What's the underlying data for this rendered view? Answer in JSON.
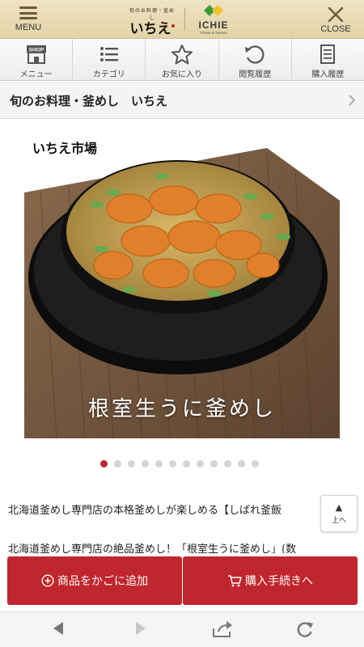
{
  "header": {
    "menu_label": "MENU",
    "close_label": "CLOSE",
    "logo_left_small": "旬のお料理・釜めし",
    "logo_left_main": "いちえ",
    "logo_right_word": "ICHIE",
    "logo_right_sub": "Flower & Sweets"
  },
  "nav": {
    "items": [
      {
        "label": "メニュー",
        "icon": "shop-icon",
        "badge": "SHOP"
      },
      {
        "label": "カテゴリ",
        "icon": "list-icon"
      },
      {
        "label": "お気に入り",
        "icon": "star-icon"
      },
      {
        "label": "閲覧履歴",
        "icon": "history-icon"
      },
      {
        "label": "購入履歴",
        "icon": "receipt-icon"
      }
    ]
  },
  "breadcrumb": {
    "text": "旬のお料理・釜めし　いちえ"
  },
  "hero": {
    "brand": "いちえ市場",
    "caption": "根室生うに釜めし",
    "slide_count": 12,
    "active_slide": 1
  },
  "description": {
    "line1": "北海道釜めし専門店の本格釜めしが楽しめる【しばれ釜飯",
    "line2": "北海道釜めし専門店の絶品釜めし！「根室生うに釜めし」(数"
  },
  "to_top": {
    "arrow": "▲",
    "label": "上へ"
  },
  "actions": {
    "add_to_cart": "商品をかごに追加",
    "checkout": "購入手続きへ"
  },
  "colors": {
    "accent": "#c0262d",
    "header": "#e9dcb6"
  }
}
